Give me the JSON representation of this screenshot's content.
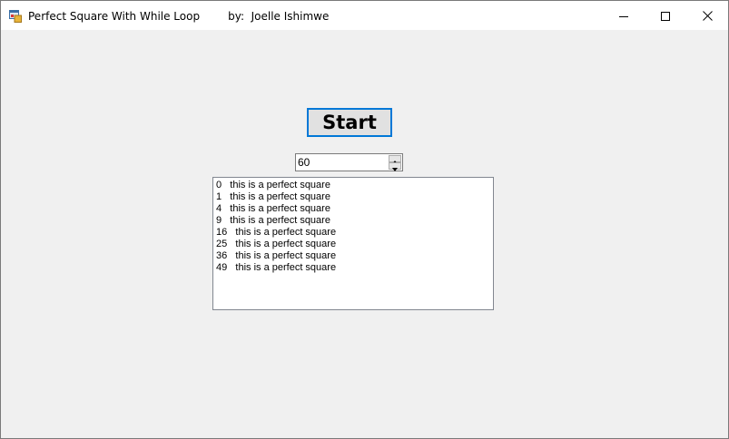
{
  "window": {
    "title": "Perfect Square With While Loop",
    "author_label": "by:  Joelle Ishimwe"
  },
  "controls": {
    "start_label": "Start",
    "number_value": "60"
  },
  "output": {
    "items": [
      "0   this is a perfect square",
      "1   this is a perfect square",
      "4   this is a perfect square",
      "9   this is a perfect square",
      "16   this is a perfect square",
      "25   this is a perfect square",
      "36   this is a perfect square",
      "49   this is a perfect square"
    ]
  },
  "icons": {
    "app": "windows-form-icon",
    "minimize": "minimize-icon",
    "maximize": "maximize-icon",
    "close": "close-icon",
    "spin_up": "chevron-up-icon",
    "spin_down": "chevron-down-icon"
  },
  "colors": {
    "client_background": "#f0f0f0",
    "focus_border": "#0078d7",
    "titlebar_background": "#ffffff"
  }
}
